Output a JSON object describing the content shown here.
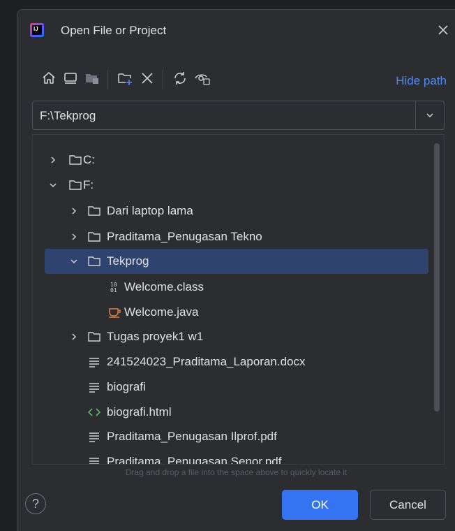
{
  "dialog": {
    "title": "Open File or Project",
    "logo_text": "IJ"
  },
  "toolbar": {
    "icons": [
      "home-icon",
      "desktop-icon",
      "project-folder-icon",
      "new-folder-icon",
      "delete-icon",
      "refresh-icon",
      "show-hidden-icon"
    ],
    "hide_path_label": "Hide path"
  },
  "path": {
    "value": "F:\\Tekprog",
    "placeholder": ""
  },
  "tree": {
    "items": [
      {
        "label": "C:",
        "type": "folder",
        "expanded": false,
        "level": 0
      },
      {
        "label": "F:",
        "type": "folder",
        "expanded": true,
        "level": 0
      },
      {
        "label": "Dari laptop lama",
        "type": "folder",
        "expanded": false,
        "level": 1
      },
      {
        "label": "Praditama_Penugasan Tekno",
        "type": "folder",
        "expanded": false,
        "level": 1
      },
      {
        "label": "Tekprog",
        "type": "folder",
        "expanded": true,
        "level": 1,
        "selected": true
      },
      {
        "label": "Welcome.class",
        "type": "class",
        "level": 2
      },
      {
        "label": "Welcome.java",
        "type": "java",
        "level": 2
      },
      {
        "label": "Tugas proyek1 w1",
        "type": "folder",
        "expanded": false,
        "level": 1
      },
      {
        "label": "241524023_Praditama_Laporan.docx",
        "type": "text",
        "level": 1
      },
      {
        "label": "biografi",
        "type": "text",
        "level": 1
      },
      {
        "label": "biografi.html",
        "type": "html",
        "level": 1
      },
      {
        "label": "Praditama_Penugasan Ilprof.pdf",
        "type": "text",
        "level": 1
      },
      {
        "label": "Praditama_Penugasan Senor.pdf",
        "type": "text",
        "level": 1
      }
    ],
    "class_icon_text": "10\n01"
  },
  "hint": "Drag and drop a file into the space above to quickly locate it",
  "footer": {
    "help_label": "?",
    "ok_label": "OK",
    "cancel_label": "Cancel"
  },
  "colors": {
    "accent": "#3574f0",
    "link": "#548af7",
    "selection": "#2e436e",
    "background": "#2b2d30",
    "java_icon": "#e87d3e",
    "html_icon": "#5fb865"
  }
}
